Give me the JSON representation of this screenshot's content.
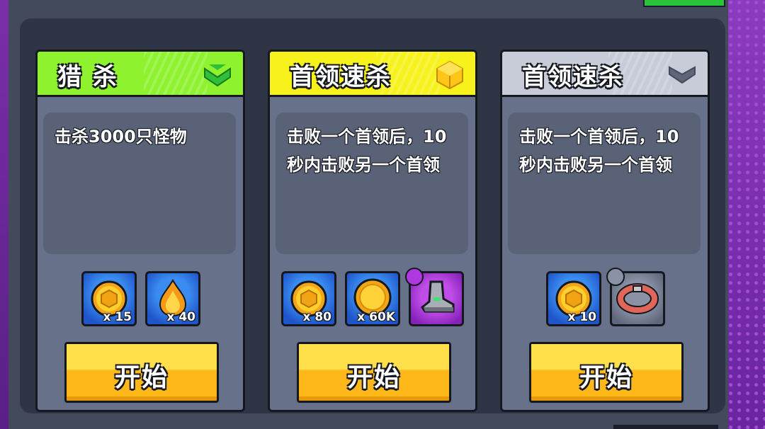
{
  "cards": [
    {
      "title": "猎 杀",
      "header_color": "#8ef22e",
      "badge": "green-chevron-icon",
      "description": "击杀3000只怪物",
      "rewards": [
        {
          "icon": "gold-chest-coin-icon",
          "qty": "x 15",
          "frame": "blue"
        },
        {
          "icon": "orange-flame-drop-icon",
          "qty": "x 40",
          "frame": "blue"
        }
      ],
      "button": "开始"
    },
    {
      "title": "首领速杀",
      "header_color": "#f7f21c",
      "badge": "gold-cube-icon",
      "description": "击败一个首领后，10秒内击败另一个首领",
      "rewards": [
        {
          "icon": "gold-chest-coin-icon",
          "qty": "x 80",
          "frame": "blue"
        },
        {
          "icon": "gold-coin-icon",
          "qty": "x 60K",
          "frame": "blue"
        },
        {
          "icon": "boot-icon",
          "qty": "",
          "frame": "purple"
        }
      ],
      "button": "开始"
    },
    {
      "title": "首领速杀",
      "header_color": "#c7ccd8",
      "badge": "gray-chevron-icon",
      "description": "击败一个首领后，10秒内击败另一个首领",
      "rewards": [
        {
          "icon": "gold-chest-coin-icon",
          "qty": "x 10",
          "frame": "blue"
        },
        {
          "icon": "red-belt-icon",
          "qty": "",
          "frame": "gray"
        }
      ],
      "button": "开始"
    }
  ]
}
